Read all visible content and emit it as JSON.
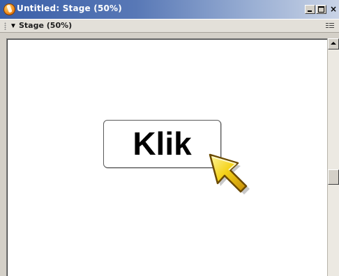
{
  "window": {
    "title": "Untitled: Stage (50%)",
    "controls": {
      "minimize": "minimize",
      "maximize": "maximize",
      "close_label": "×"
    }
  },
  "panel": {
    "title": "Stage (50%)",
    "collapse_icon": "▼",
    "options_icon": "panel-options-icon"
  },
  "stage": {
    "button_label": "Klik",
    "cursor_icon": "pointer-arrow-icon",
    "cursor_color": "#f4d21a"
  },
  "colors": {
    "titlebar_start": "#3a5fa8",
    "titlebar_end": "#c9d3e6",
    "chrome": "#d4d0c8",
    "stage_background": "#ffffff"
  }
}
